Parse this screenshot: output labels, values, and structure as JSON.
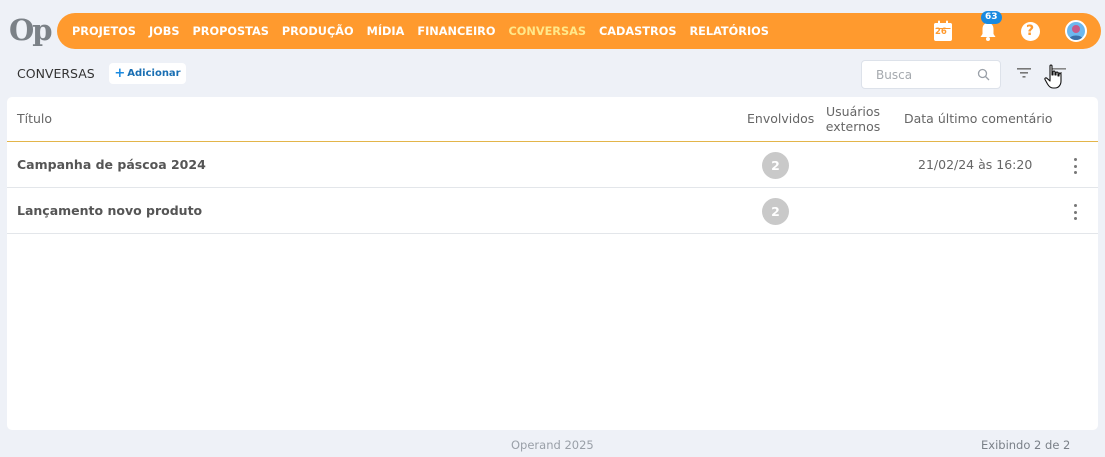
{
  "app": {
    "logo_text": "Op",
    "brand_color": "#ff9a2e",
    "active_color": "#ffe88a"
  },
  "nav": {
    "items": [
      {
        "label": "PROJETOS"
      },
      {
        "label": "JOBS"
      },
      {
        "label": "PROPOSTAS"
      },
      {
        "label": "PRODUÇÃO"
      },
      {
        "label": "MÍDIA"
      },
      {
        "label": "FINANCEIRO"
      },
      {
        "label": "CONVERSAS",
        "active": true
      },
      {
        "label": "CADASTROS"
      },
      {
        "label": "RELATÓRIOS"
      }
    ],
    "calendar_day": "26",
    "notifications_count": "63",
    "help_label": "?",
    "icons": [
      "calendar-icon",
      "bell-icon",
      "help-icon",
      "avatar"
    ]
  },
  "toolbar": {
    "page_title": "CONVERSAS",
    "add_label": "Adicionar",
    "add_plus": "+",
    "search_placeholder": "Busca"
  },
  "table": {
    "headers": {
      "title": "Título",
      "involved": "Envolvidos",
      "external_line1": "Usuários",
      "external_line2": "externos",
      "last_comment": "Data último comentário"
    },
    "rows": [
      {
        "title": "Campanha de páscoa 2024",
        "involved": "2",
        "last_comment": "21/02/24 às 16:20"
      },
      {
        "title": "Lançamento novo produto",
        "involved": "2",
        "last_comment": ""
      }
    ]
  },
  "footer": {
    "copyright": "Operand 2025",
    "count_text": "Exibindo 2 de 2"
  }
}
